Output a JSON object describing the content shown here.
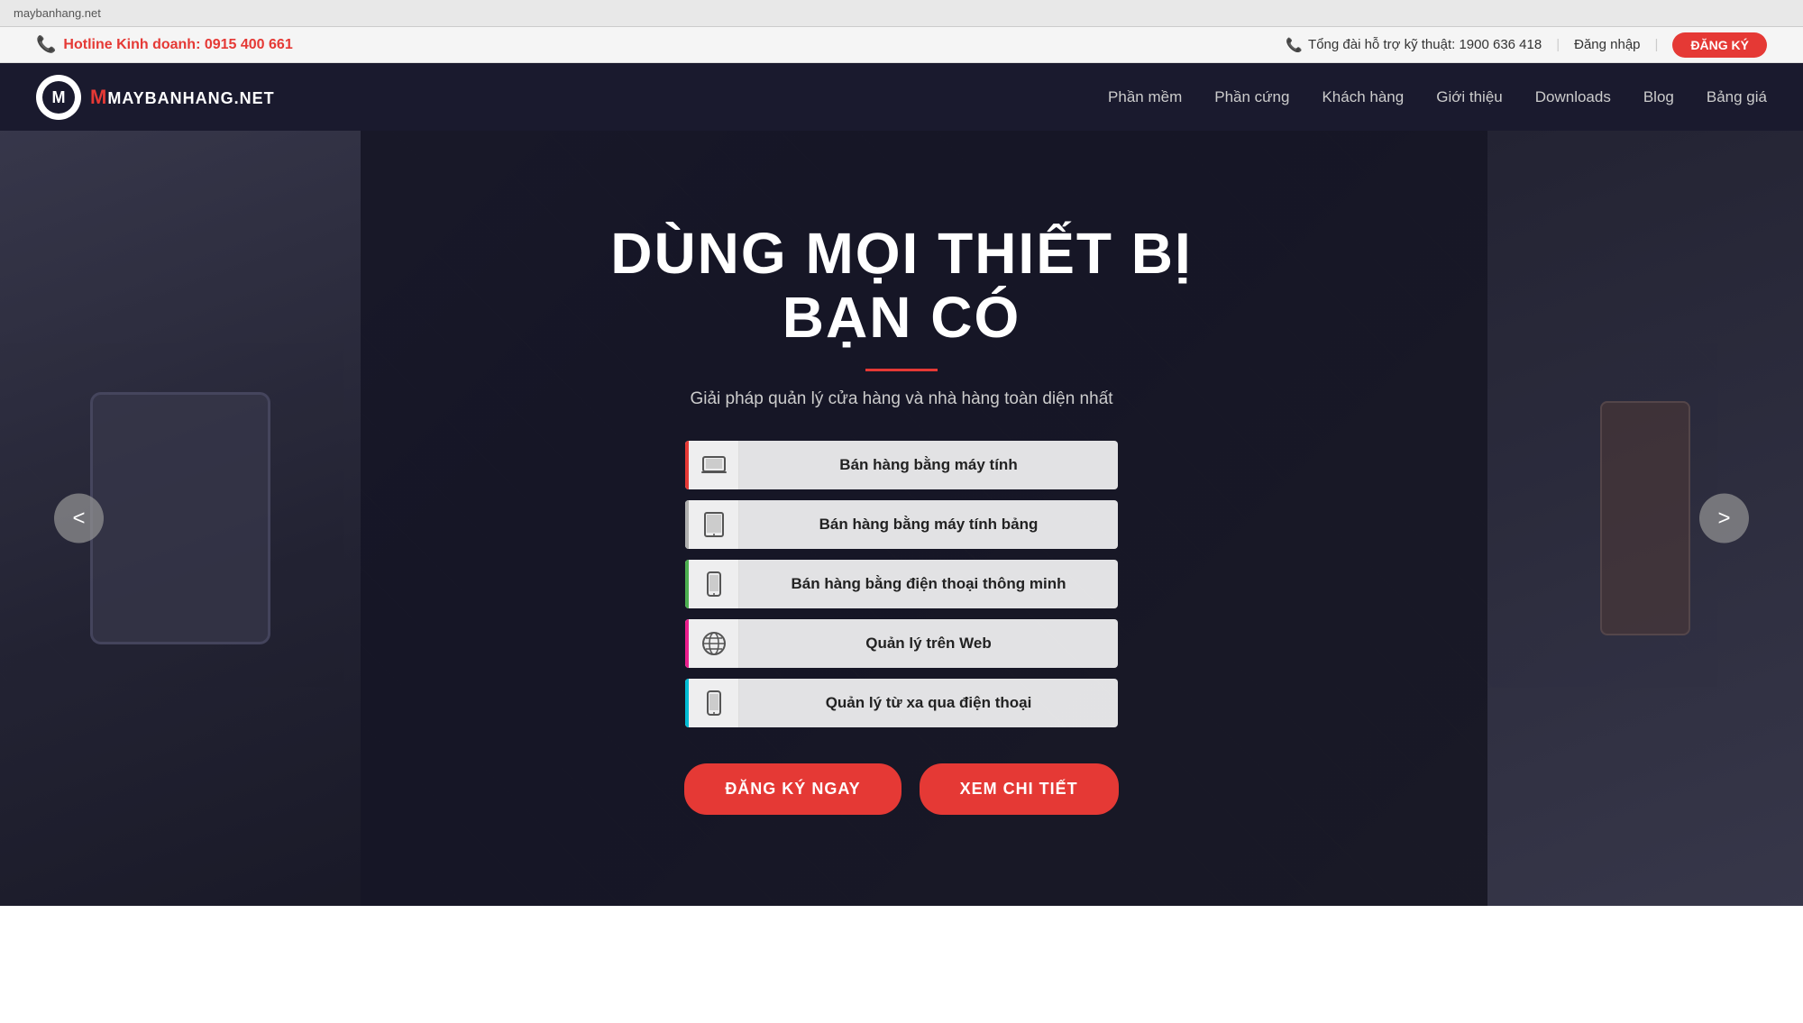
{
  "browser": {
    "url": "maybanhang.net"
  },
  "topbar": {
    "hotline_label": "Hotline Kinh doanh: 0915 400 661",
    "support_label": "Tổng đài hỗ trợ kỹ thuật: 1900 636 418",
    "login_label": "Đăng nhập",
    "register_label": "ĐĂNG KÝ"
  },
  "navbar": {
    "logo_text": "MAYBANHANG.NET",
    "links": [
      {
        "label": "Phần mềm",
        "id": "phan-mem"
      },
      {
        "label": "Phần cứng",
        "id": "phan-cung"
      },
      {
        "label": "Khách hàng",
        "id": "khach-hang"
      },
      {
        "label": "Giới thiệu",
        "id": "gioi-thieu"
      },
      {
        "label": "Downloads",
        "id": "downloads"
      },
      {
        "label": "Blog",
        "id": "blog"
      },
      {
        "label": "Bảng giá",
        "id": "bang-gia"
      }
    ]
  },
  "hero": {
    "title": "DÙNG MỌI THIẾT BỊ BẠN CÓ",
    "subtitle": "Giải pháp quản lý cửa hàng và nhà hàng toàn diện nhất",
    "features": [
      {
        "id": "laptop",
        "label": "Bán hàng bằng máy tính",
        "icon": "💻",
        "active_class": "active-laptop"
      },
      {
        "id": "tablet",
        "label": "Bán hàng bằng máy tính bảng",
        "icon": "📱",
        "active_class": "active-tablet"
      },
      {
        "id": "phone",
        "label": "Bán hàng bằng điện thoại thông minh",
        "icon": "📱",
        "active_class": "active-phone"
      },
      {
        "id": "web",
        "label": "Quản lý trên Web",
        "icon": "🌐",
        "active_class": "active-web"
      },
      {
        "id": "remote",
        "label": "Quản lý từ xa qua điện thoại",
        "icon": "📱",
        "active_class": "active-remote"
      }
    ],
    "cta_primary": "ĐĂNG KÝ NGAY",
    "cta_secondary": "XEM CHI TIẾT",
    "arrow_left": "<",
    "arrow_right": ">"
  }
}
